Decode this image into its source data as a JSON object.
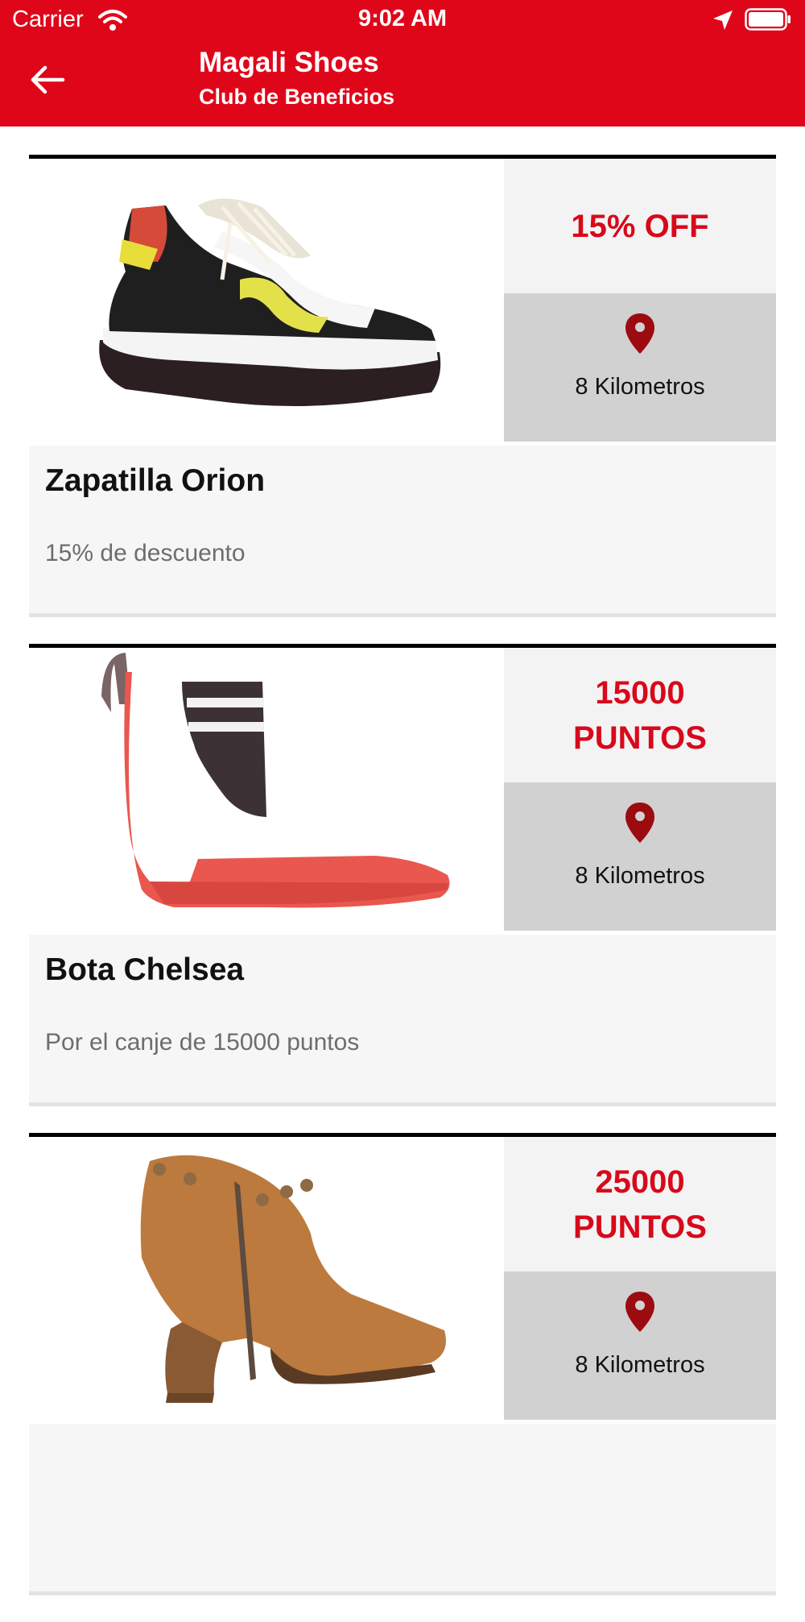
{
  "status_bar": {
    "carrier": "Carrier",
    "time": "9:02 AM"
  },
  "header": {
    "title": "Magali Shoes",
    "subtitle": "Club de Beneficios",
    "back_icon": "arrow-left-icon",
    "background": "#e0061a"
  },
  "cards": [
    {
      "offer": "15% OFF",
      "distance": "8 Kilometros",
      "title": "Zapatilla Orion",
      "description": "15% de descuento",
      "image": "sneaker"
    },
    {
      "offer": "15000 PUNTOS",
      "distance": "8 Kilometros",
      "title": "Bota Chelsea",
      "description": "Por el canje de 15000 puntos",
      "image": "chelsea-boot"
    },
    {
      "offer": "25000 PUNTOS",
      "distance": "8 Kilometros",
      "title": "",
      "description": "",
      "image": "ankle-boot"
    }
  ],
  "colors": {
    "accent": "#d8091b",
    "pin": "#9b0b10",
    "offer_bg": "#f3f3f3",
    "distance_bg": "#d1d1d1"
  }
}
